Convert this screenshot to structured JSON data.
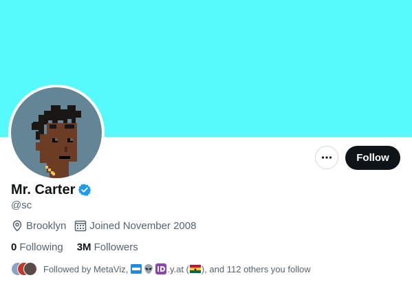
{
  "profile": {
    "display_name": "Mr. Carter",
    "handle": "@sc",
    "location": "Brooklyn",
    "joined": "Joined November 2008",
    "following_count": "0",
    "following_label": "Following",
    "followers_count": "3M",
    "followers_label": "Followers"
  },
  "actions": {
    "follow_label": "Follow"
  },
  "followed_by": {
    "prefix": "Followed by MetaViz,",
    "yat_text": ".y.at (",
    "suffix": "), and 112 others you follow"
  },
  "colors": {
    "banner": "#55fafd",
    "accent": "#1d9bf0",
    "text_primary": "#0f1419",
    "text_secondary": "#536471"
  },
  "icons": [
    "more-icon",
    "verified-badge-icon",
    "location-pin-icon",
    "calendar-icon",
    "alien-emoji-icon",
    "id-emoji-icon",
    "ghana-flag-icon"
  ]
}
